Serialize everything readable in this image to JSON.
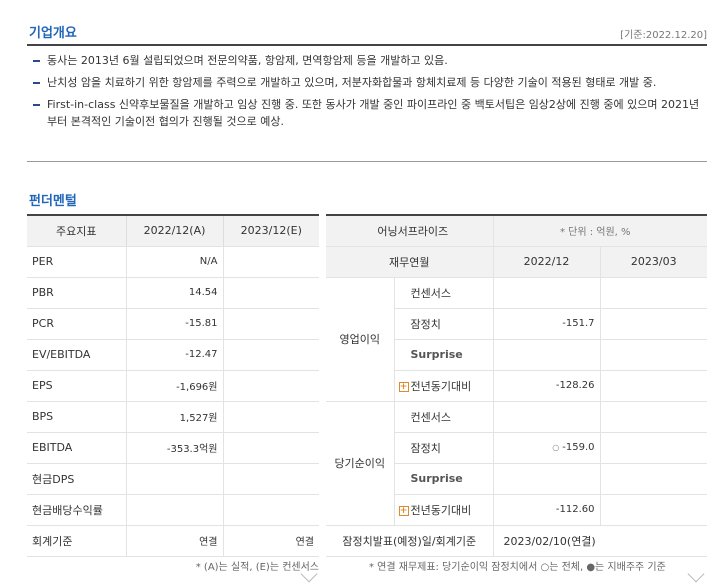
{
  "overview": {
    "title": "기업개요",
    "ref_date": "[기준:2022.12.20]",
    "items": [
      "동사는 2013년 6월 설립되었으며 전문의약품, 항암제, 면역항암제 등을 개발하고 있음.",
      "난치성 암을 치료하기 위한 항암제를 주력으로 개발하고 있으며, 저분자화합물과 항체치료제 등 다양한 기술이 적용된 형태로 개발 중.",
      "First-in-class 신약후보물질을 개발하고 임상 진행 중. 또한 동사가 개발 중인 파이프라인 중 백토서팁은 임상2상에 진행 중에 있으며 2021년부터 본격적인 기술이전 협의가 진행될 것으로 예상."
    ]
  },
  "fundamentals": {
    "title": "펀더멘털",
    "headers": [
      "주요지표",
      "2022/12(A)",
      "2023/12(E)"
    ],
    "rows": [
      {
        "label": "PER",
        "a": "N/A",
        "e": ""
      },
      {
        "label": "PBR",
        "a": "14.54",
        "e": ""
      },
      {
        "label": "PCR",
        "a": "-15.81",
        "e": ""
      },
      {
        "label": "EV/EBITDA",
        "a": "-12.47",
        "e": ""
      },
      {
        "label": "EPS",
        "a": "-1,696원",
        "e": ""
      },
      {
        "label": "BPS",
        "a": "1,527원",
        "e": ""
      },
      {
        "label": "EBITDA",
        "a": "-353.3억원",
        "e": ""
      },
      {
        "label": "현금DPS",
        "a": "",
        "e": ""
      },
      {
        "label": "현금배당수익률",
        "a": "",
        "e": ""
      },
      {
        "label": "회계기준",
        "a": "연결",
        "e": "연결"
      }
    ],
    "note": "* (A)는 실적, (E)는 컨센서스"
  },
  "earnings": {
    "title": "어닝서프라이즈",
    "unit": "* 단위 : 억원, %",
    "headers": [
      "재무연월",
      "2022/12",
      "2023/03"
    ],
    "groups": [
      {
        "name": "영업이익",
        "rows": [
          {
            "label": "컨센서스",
            "v1": "",
            "v2": ""
          },
          {
            "label": "잠정치",
            "v1": "-151.7",
            "v2": ""
          },
          {
            "label": "Surprise",
            "v1": "",
            "v2": ""
          },
          {
            "label": "전년동기대비",
            "v1": "-128.26",
            "v2": ""
          }
        ]
      },
      {
        "name": "당기순이익",
        "rows": [
          {
            "label": "컨센서스",
            "v1": "",
            "v2": ""
          },
          {
            "label": "잠정치",
            "v1": "-159.0",
            "v2": ""
          },
          {
            "label": "Surprise",
            "v1": "",
            "v2": ""
          },
          {
            "label": "전년동기대비",
            "v1": "-112.60",
            "v2": ""
          }
        ]
      }
    ],
    "footer_label": "잠정치발표(예정)일/회계기준",
    "footer_value": "2023/02/10(연결)",
    "note": "* 연결 재무제표: 당기순이익 잠정치에서 ○는 전체, ●는 지배주주 기준"
  }
}
